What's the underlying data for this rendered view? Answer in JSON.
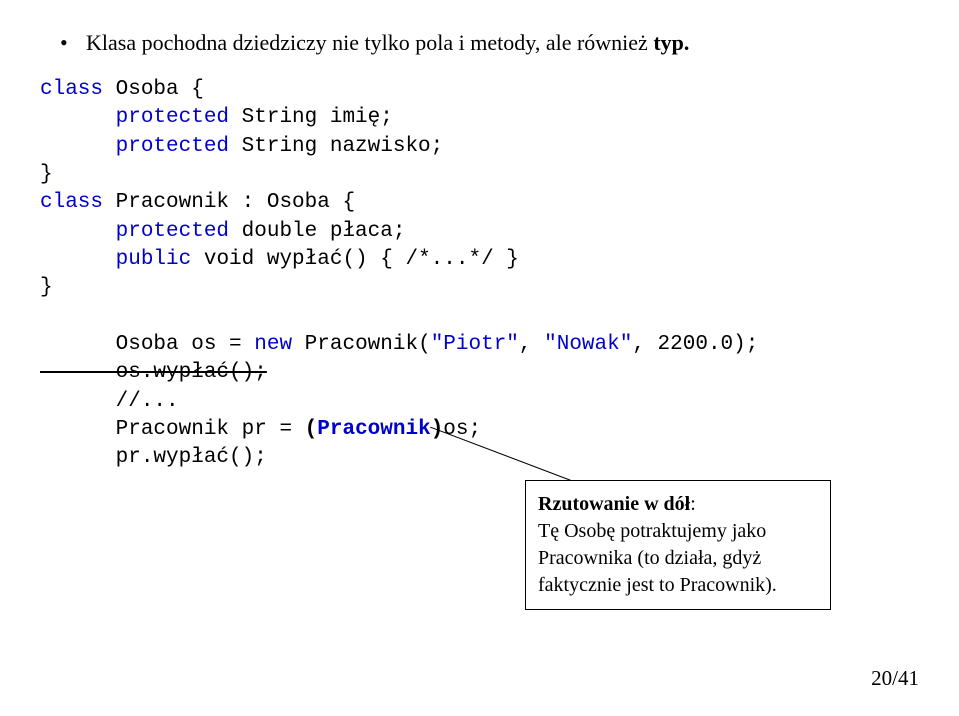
{
  "bullet": {
    "text": "Klasa pochodna dziedziczy nie tylko pola i metody, ale również ",
    "bold_suffix": "typ."
  },
  "code": {
    "l1a": "class",
    "l1b": " Osoba {",
    "l2a": "      protected",
    "l2b": " String imię;",
    "l3a": "      protected",
    "l3b": " String nazwisko;",
    "l4": "}",
    "l5a": "class",
    "l5b": " Pracownik : Osoba {",
    "l6a": "      protected",
    "l6b": " double płaca;",
    "l7a": "      public",
    "l7b": " void wypłać() { /*...*/ }",
    "l8": "}",
    "l9a": "      Osoba os = ",
    "l9b": "new",
    "l9c": " Pracownik(",
    "l9d": "\"Piotr\"",
    "l9e": ", ",
    "l9f": "\"Nowak\"",
    "l9g": ", 2200.0);",
    "l10": "      os.wypłać();",
    "l11": "      //...",
    "l12a": "      Pracownik pr = ",
    "l12b": "(",
    "l12c": "Pracownik",
    "l12d": ")",
    "l12e": "os;",
    "l13": "      pr.wypłać();"
  },
  "callout": {
    "title": "Rzutowanie w dół",
    "rest": ":\nTę Osobę potraktujemy jako Pracownika (to działa, gdyż faktycznie jest to Pracownik)."
  },
  "page": "20/41"
}
